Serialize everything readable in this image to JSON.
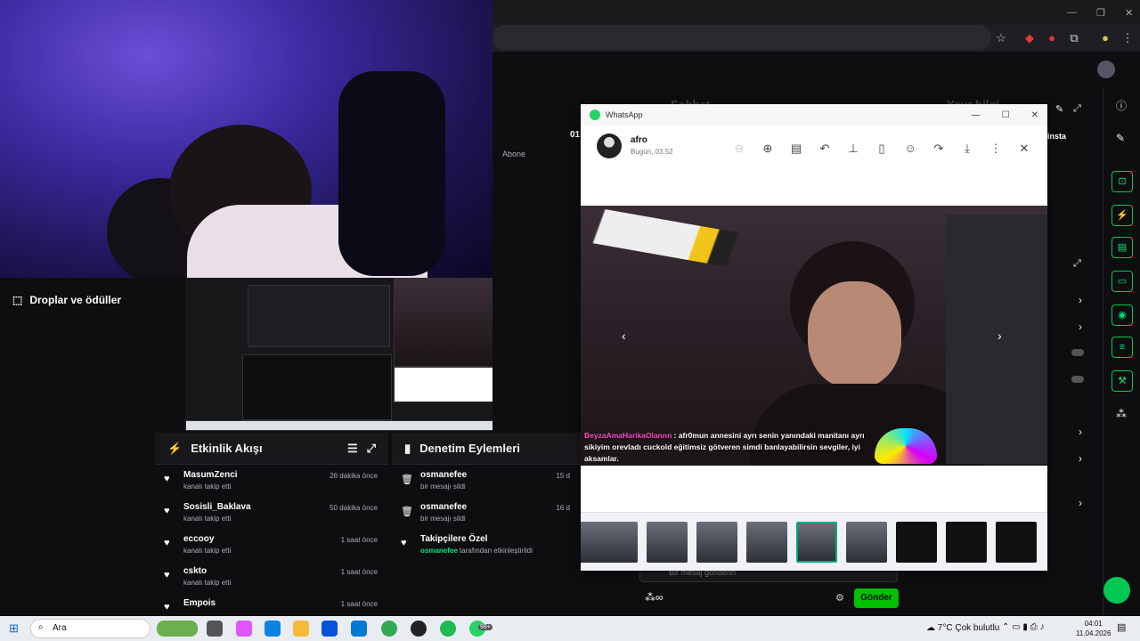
{
  "webcam": {
    "section_label": "Droplar ve ödüller"
  },
  "activity": {
    "title": "Etkinlik Akışı",
    "items": [
      {
        "user": "MasumZenci",
        "action": "kanalı takip etti",
        "time": "26 dakika önce"
      },
      {
        "user": "Sosisli_Baklava",
        "action": "kanalı takip etti",
        "time": "50 dakika önce"
      },
      {
        "user": "eccooy",
        "action": "kanalı takip etti",
        "time": "1 saat önce"
      },
      {
        "user": "cskto",
        "action": "kanalı takip etti",
        "time": "1 saat önce"
      },
      {
        "user": "Empois",
        "action": "",
        "time": "1 saat önce"
      }
    ]
  },
  "moderation": {
    "title": "Denetim Eylemleri",
    "items": [
      {
        "user": "osmanefee",
        "action": "bir mesajı sildi",
        "time": "15 d"
      },
      {
        "user": "osmanefee",
        "action": "bir mesajı sildi",
        "time": "16 d"
      },
      {
        "user": "Takipçilere Özel",
        "action_user": "osmanefee",
        "action": "tarafından etkinleştirildi",
        "time": ""
      }
    ]
  },
  "behind": {
    "chat_label": "Sohbet",
    "user_info_label": "Your bilgi",
    "abone": "Abone",
    "insta": "insta",
    "count_partial": "01"
  },
  "whatsapp": {
    "app_title": "WhatsApp",
    "contact_name": "afro",
    "date": "Bugün, 03.52",
    "caption_user": "BeyzaAmaHarikaOlannn",
    "caption_text": " : afr0mun annesini ayrı senin yanındaki manitanı ayrı sikiyim orevladı cuckold eğitimsiz götveren simdi banlayabilirsin sevgiler, iyi aksamlar.",
    "tools": [
      "zoom-out-icon",
      "zoom-in-icon",
      "caption-icon",
      "reply-icon",
      "pin-icon",
      "bookmark-icon",
      "emoji-icon",
      "forward-icon",
      "download-icon",
      "more-icon",
      "close-icon"
    ]
  },
  "chat": {
    "placeholder": "Bir mesaj gönderin",
    "send_label": "Gönder"
  },
  "taskbar": {
    "search_placeholder": "Ara",
    "weather": "7°C Çok bulutlu",
    "time": "04:01",
    "date": "11.04.2026",
    "badge": "99+"
  },
  "colors": {
    "accent_green": "#00c853",
    "whatsapp_green": "#25d366",
    "twitch_dark": "#0e0e10",
    "webcam_purple": "#3b2aa0"
  }
}
